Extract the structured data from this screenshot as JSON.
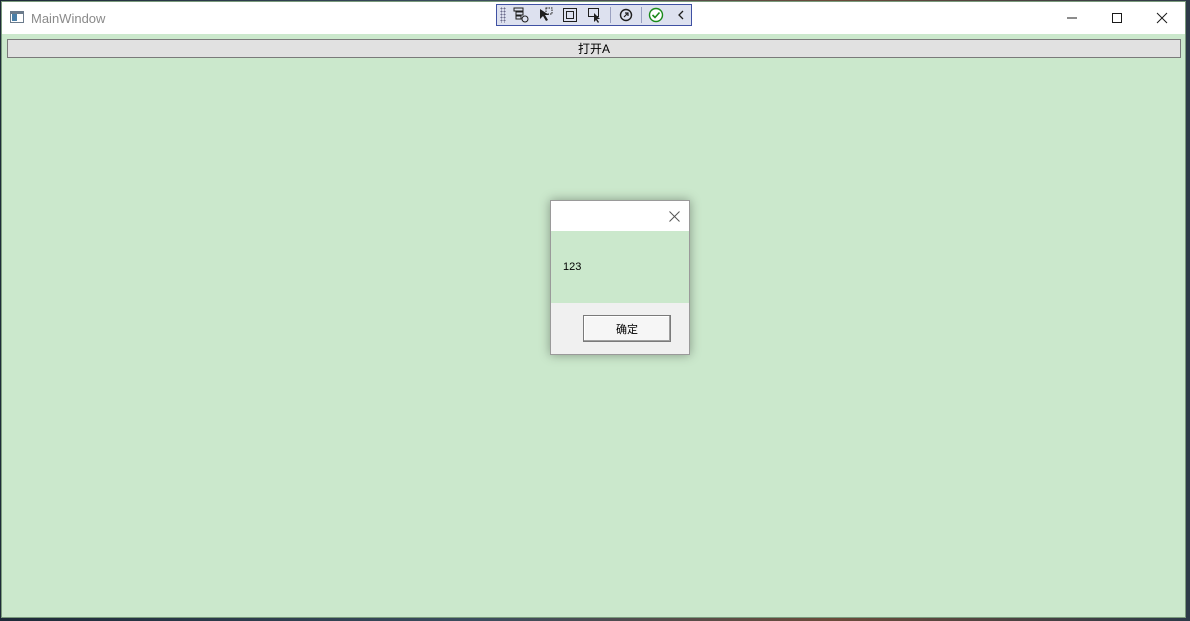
{
  "window": {
    "title": "MainWindow",
    "background_color": "#cbe8cc"
  },
  "debug_toolbar": {
    "icons": [
      "live-visual-tree-icon",
      "select-element-icon",
      "display-layout-adorners-icon",
      "track-focused-element-icon",
      "hot-reload-icon",
      "binding-check-icon",
      "collapse-icon"
    ]
  },
  "title_controls": {
    "minimize": "minimize-icon",
    "maximize": "maximize-icon",
    "close": "close-icon"
  },
  "main": {
    "open_button_label": "打开A"
  },
  "dialog": {
    "message": "123",
    "ok_label": "确定"
  }
}
